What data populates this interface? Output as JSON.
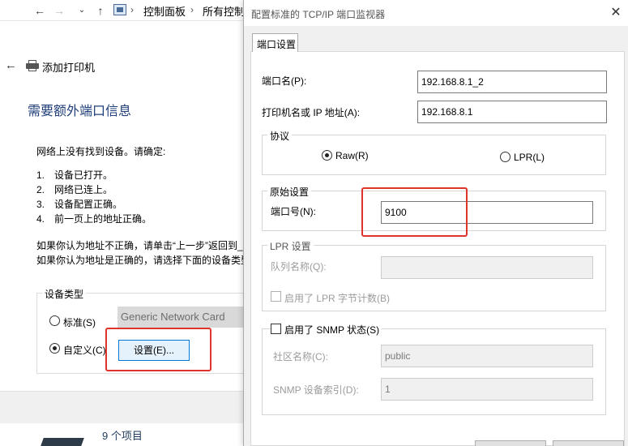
{
  "explorer": {
    "back_icon": "arrow-left-icon",
    "forward_icon": "arrow-right-icon",
    "recent_icon": "chevron-down-icon",
    "up_icon": "arrow-up-icon",
    "crumb_1": "控制面板",
    "crumb_2": "所有控制",
    "items_count": "9 个项目"
  },
  "wizard": {
    "title": "添加打印机",
    "heading": "需要额外端口信息",
    "intro": "网络上没有找到设备。请确定:",
    "list": [
      {
        "num": "1.",
        "text": "设备已打开。"
      },
      {
        "num": "2.",
        "text": "网络已连上。"
      },
      {
        "num": "3.",
        "text": "设备配置正确。"
      },
      {
        "num": "4.",
        "text": "前一页上的地址正确。"
      }
    ],
    "note_1": "如果你认为地址不正确，请单击“上一步”返回到_",
    "note_2": "如果你认为地址是正确的，请选择下面的设备类型",
    "device_type_label": "设备类型",
    "standard_label": "标准(S)",
    "custom_label": "自定义(C)",
    "generic_card": "Generic Network Card",
    "settings_button": "设置(E)..."
  },
  "dialog": {
    "title": "配置标准的 TCP/IP 端口监视器",
    "close_symbol": "✕",
    "tab_label": "端口设置",
    "port_name_label": "端口名(P):",
    "port_name_value": "192.168.8.1_2",
    "printer_name_label": "打印机名或 IP 地址(A):",
    "printer_name_value": "192.168.8.1",
    "protocol_label": "协议",
    "raw_label": "Raw(R)",
    "lpr_label": "LPR(L)",
    "raw_settings_label": "原始设置",
    "port_number_label": "端口号(N):",
    "port_number_value": "9100",
    "lpr_settings_label": "LPR 设置",
    "queue_name_label": "队列名称(Q):",
    "queue_name_value": "",
    "lpr_byte_count_label": "启用了 LPR 字节计数(B)",
    "snmp_label": "启用了 SNMP 状态(S)",
    "community_label": "社区名称(C):",
    "community_value": "public",
    "snmp_index_label": "SNMP 设备索引(D):",
    "snmp_index_value": "1"
  },
  "colors": {
    "highlight_box": "#e0332b",
    "heading_blue": "#1f3e7a",
    "focus_blue": "#0078d7"
  }
}
